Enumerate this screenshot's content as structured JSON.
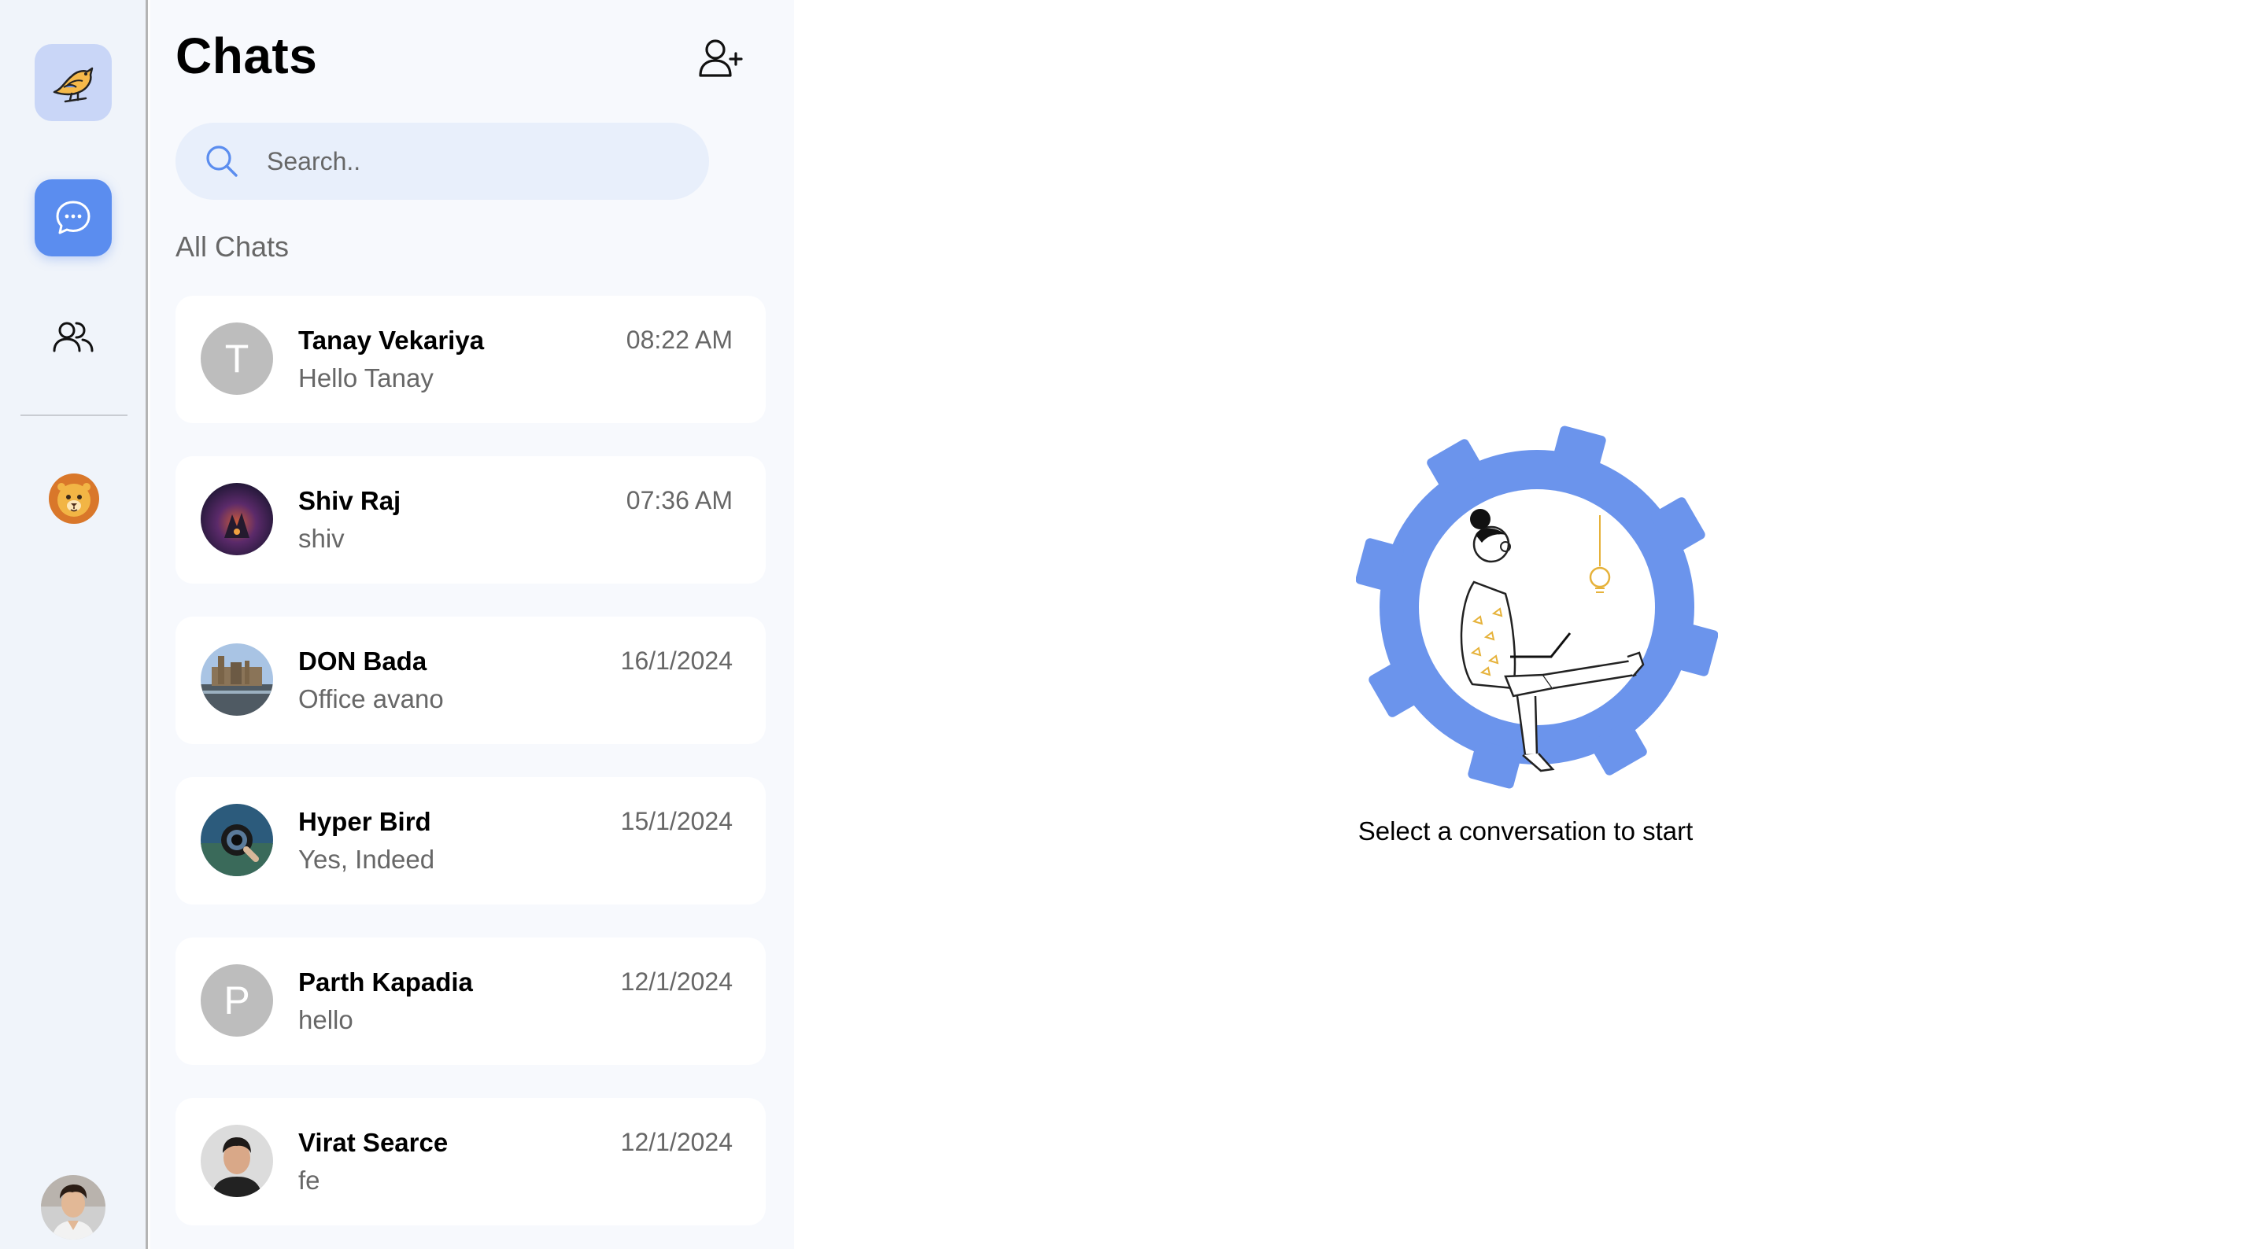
{
  "rail": {
    "items": [
      {
        "name": "app-logo",
        "icon": "bird-icon"
      },
      {
        "name": "chats",
        "icon": "chat-bubble-icon",
        "active": true
      },
      {
        "name": "groups",
        "icon": "users-icon"
      },
      {
        "name": "profile-avatar",
        "icon": "lion-icon"
      },
      {
        "name": "user-avatar",
        "icon": "user-photo"
      }
    ]
  },
  "panel": {
    "title": "Chats",
    "add_user_icon": "add-user-icon",
    "search": {
      "placeholder": "Search..",
      "value": ""
    },
    "section_label": "All Chats"
  },
  "chats": [
    {
      "name": "Tanay Vekariya",
      "message": "Hello Tanay",
      "time": "08:22 AM",
      "avatar_letter": "T",
      "avatar_type": "letter"
    },
    {
      "name": "Shiv Raj",
      "message": "shiv",
      "time": "07:36 AM",
      "avatar_type": "photo",
      "avatar_colors": [
        "#2b1e3c",
        "#7a3a6a"
      ]
    },
    {
      "name": "DON Bada",
      "message": "Office avano",
      "time": "16/1/2024",
      "avatar_type": "photo",
      "avatar_colors": [
        "#9bb8d8",
        "#5a4a3a"
      ]
    },
    {
      "name": "Hyper Bird",
      "message": "Yes, Indeed",
      "time": "15/1/2024",
      "avatar_type": "photo",
      "avatar_colors": [
        "#2d5a7a",
        "#111111"
      ]
    },
    {
      "name": "Parth Kapadia",
      "message": "hello",
      "time": "12/1/2024",
      "avatar_letter": "P",
      "avatar_type": "letter"
    },
    {
      "name": "Virat Searce",
      "message": "fe",
      "time": "12/1/2024",
      "avatar_type": "photo",
      "avatar_colors": [
        "#d8d8d8",
        "#2a2a2a"
      ]
    }
  ],
  "main": {
    "empty_state_text": "Select a conversation to start",
    "illustration": "person-with-laptop-in-gear-illustration"
  },
  "colors": {
    "accent": "#5b8def",
    "rail_bg": "#f0f4fa",
    "panel_bg": "#f7f9fd",
    "search_bg": "#e8effb",
    "muted_text": "#676767",
    "gear": "#6b94ec"
  }
}
